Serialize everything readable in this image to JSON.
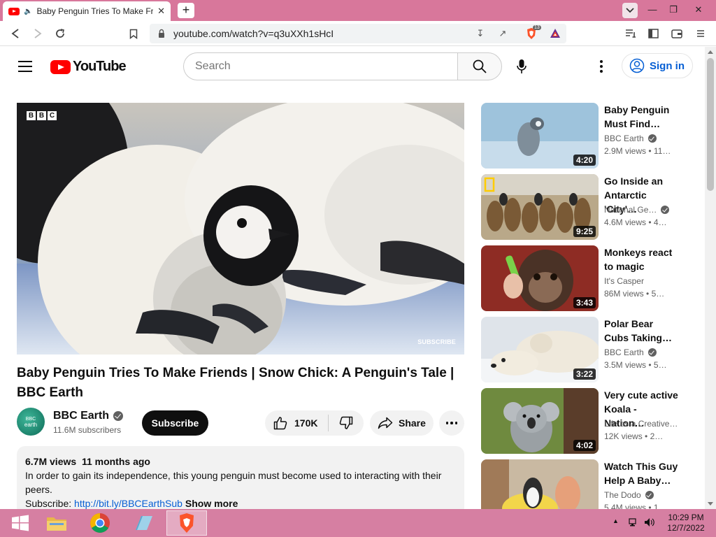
{
  "browser": {
    "tab_title": "Baby Penguin Tries To Make Friends | Snow Chick: A Penguin's Tale | BBC Earth",
    "url": "youtube.com/watch?v=q3uXXh1sHcI",
    "shield_badge": "13"
  },
  "header": {
    "logo_text": "YouTube",
    "search_placeholder": "Search",
    "signin_label": "Sign in"
  },
  "player": {
    "watermark_letters": [
      "B",
      "B",
      "C"
    ],
    "subscribe_watermark": "SUBSCRIBE"
  },
  "video": {
    "title": "Baby Penguin Tries To Make Friends | Snow Chick: A Penguin's Tale | BBC Earth",
    "channel": "BBC Earth",
    "subscribers": "11.6M subscribers",
    "subscribe_label": "Subscribe",
    "likes": "170K",
    "share_label": "Share"
  },
  "description": {
    "views": "6.7M views",
    "age": "11 months ago",
    "text": "In order to gain its independence, this young penguin must become used to interacting with their peers.",
    "subscribe_prefix": "Subscribe: ",
    "link": "http://bit.ly/BBCEarthSub",
    "show_more": "Show more"
  },
  "recommendations": [
    {
      "title": "Baby Penguin Must Find…",
      "channel": "BBC Earth",
      "verified": true,
      "views": "2.9M views",
      "age": "• 11…",
      "duration": "4:20"
    },
    {
      "title": "Go Inside an Antarctic 'City'…",
      "channel": "National Ge…",
      "verified": true,
      "views": "4.6M views",
      "age": "• 4…",
      "duration": "9:25"
    },
    {
      "title": "Monkeys react to magic",
      "channel": "It's Casper",
      "verified": false,
      "views": "86M views",
      "age": "• 5…",
      "duration": "3:43"
    },
    {
      "title": "Polar Bear Cubs Taking…",
      "channel": "BBC Earth",
      "verified": true,
      "views": "3.5M views",
      "age": "• 5…",
      "duration": "3:22"
    },
    {
      "title": "Very cute active Koala - Nation…",
      "channel": "Life as a Creative…",
      "verified": false,
      "views": "12K views",
      "age": "• 2…",
      "duration": "4:02"
    },
    {
      "title": "Watch This Guy Help A Baby…",
      "channel": "The Dodo",
      "verified": true,
      "views": "5.4M views",
      "age": "• 1…",
      "duration": ""
    }
  ],
  "taskbar": {
    "time": "10:29 PM",
    "date": "12/7/2022"
  },
  "colors": {
    "titlebar": "#d8779b",
    "taskbar": "#d67fa2",
    "yt_red": "#ff0000",
    "link_blue": "#065fd4"
  }
}
